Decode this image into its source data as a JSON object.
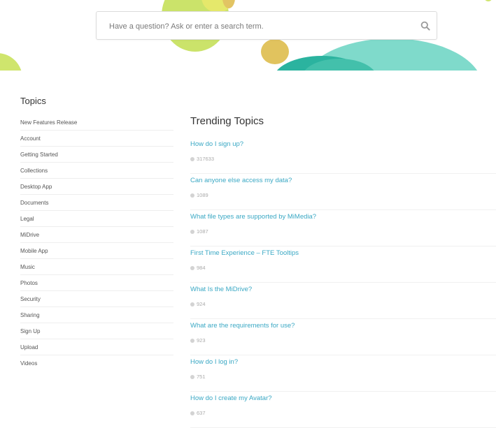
{
  "search": {
    "placeholder": "Have a question? Ask or enter a search term."
  },
  "sidebar": {
    "title": "Topics",
    "items": [
      {
        "label": "New Features Release"
      },
      {
        "label": "Account"
      },
      {
        "label": "Getting Started"
      },
      {
        "label": "Collections"
      },
      {
        "label": "Desktop App"
      },
      {
        "label": "Documents"
      },
      {
        "label": "Legal"
      },
      {
        "label": "MiDrive"
      },
      {
        "label": "Mobile App"
      },
      {
        "label": "Music"
      },
      {
        "label": "Photos"
      },
      {
        "label": "Security"
      },
      {
        "label": "Sharing"
      },
      {
        "label": "Sign Up"
      },
      {
        "label": "Upload"
      },
      {
        "label": "Videos"
      }
    ]
  },
  "main": {
    "title": "Trending Topics",
    "topics": [
      {
        "title": "How do I sign up?",
        "views": "317633"
      },
      {
        "title": "Can anyone else access my data?",
        "views": "1089"
      },
      {
        "title": "What file types are supported by MiMedia?",
        "views": "1087"
      },
      {
        "title": "First Time Experience – FTE Tooltips",
        "views": "984"
      },
      {
        "title": "What Is the MiDrive?",
        "views": "924"
      },
      {
        "title": "What are the requirements for use?",
        "views": "923"
      },
      {
        "title": "How do I log in?",
        "views": "751"
      },
      {
        "title": "How do I create my Avatar?",
        "views": "637"
      }
    ]
  },
  "colors": {
    "link": "#3aa8c4",
    "teal": "#7fdacb",
    "lime": "#cbe36a",
    "mustard": "#e1c35e"
  },
  "icons": {
    "search": "search-icon",
    "views": "view-count-dot-icon"
  }
}
